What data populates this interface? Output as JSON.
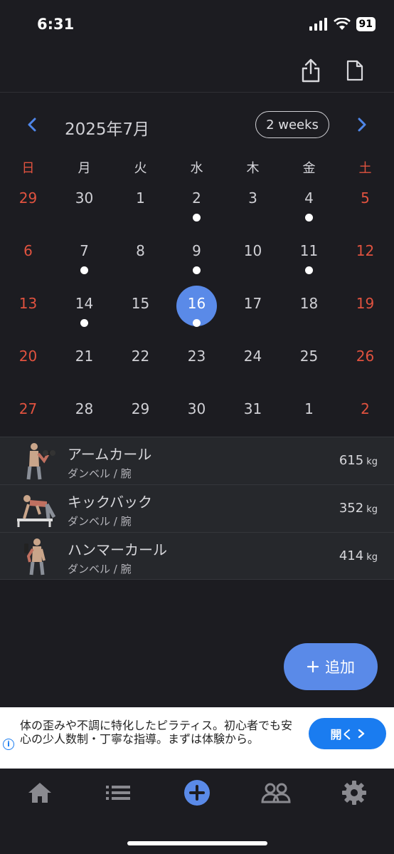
{
  "status": {
    "time": "6:31",
    "battery": "91"
  },
  "header": {
    "share_icon": "share-icon",
    "doc_icon": "document-icon"
  },
  "calendar": {
    "month_label": "2025年7月",
    "range_button": "2 weeks",
    "weekdays": [
      "日",
      "月",
      "火",
      "水",
      "木",
      "金",
      "土"
    ],
    "weeks": [
      [
        {
          "day": "29",
          "dot": false
        },
        {
          "day": "30",
          "dot": false
        },
        {
          "day": "1",
          "dot": false
        },
        {
          "day": "2",
          "dot": true
        },
        {
          "day": "3",
          "dot": false
        },
        {
          "day": "4",
          "dot": true
        },
        {
          "day": "5",
          "dot": false
        }
      ],
      [
        {
          "day": "6",
          "dot": false
        },
        {
          "day": "7",
          "dot": true
        },
        {
          "day": "8",
          "dot": false
        },
        {
          "day": "9",
          "dot": true
        },
        {
          "day": "10",
          "dot": false
        },
        {
          "day": "11",
          "dot": true
        },
        {
          "day": "12",
          "dot": false
        }
      ],
      [
        {
          "day": "13",
          "dot": false
        },
        {
          "day": "14",
          "dot": true
        },
        {
          "day": "15",
          "dot": false
        },
        {
          "day": "16",
          "dot": true,
          "selected": true
        },
        {
          "day": "17",
          "dot": false
        },
        {
          "day": "18",
          "dot": false
        },
        {
          "day": "19",
          "dot": false
        }
      ],
      [
        {
          "day": "20",
          "dot": false
        },
        {
          "day": "21",
          "dot": false
        },
        {
          "day": "22",
          "dot": false
        },
        {
          "day": "23",
          "dot": false
        },
        {
          "day": "24",
          "dot": false
        },
        {
          "day": "25",
          "dot": false
        },
        {
          "day": "26",
          "dot": false
        }
      ],
      [
        {
          "day": "27",
          "dot": false
        },
        {
          "day": "28",
          "dot": false
        },
        {
          "day": "29",
          "dot": false
        },
        {
          "day": "30",
          "dot": false
        },
        {
          "day": "31",
          "dot": false
        },
        {
          "day": "1",
          "dot": false
        },
        {
          "day": "2",
          "dot": false
        }
      ]
    ]
  },
  "exercises": [
    {
      "name": "アームカール",
      "sub": "ダンベル / 腕",
      "weight": "615",
      "unit": "kg",
      "icon": "arm-curl-icon"
    },
    {
      "name": "キックバック",
      "sub": "ダンベル / 腕",
      "weight": "352",
      "unit": "kg",
      "icon": "kickback-icon"
    },
    {
      "name": "ハンマーカール",
      "sub": "ダンベル / 腕",
      "weight": "414",
      "unit": "kg",
      "icon": "hammer-curl-icon"
    }
  ],
  "fab": {
    "label": "追加"
  },
  "ad": {
    "text": "体の歪みや不調に特化したピラティス。初心者でも安心の少人数制・丁寧な指導。まずは体験から。",
    "button": "開く"
  },
  "tabs": [
    "home-icon",
    "list-icon",
    "add-icon",
    "community-icon",
    "settings-icon"
  ],
  "colors": {
    "accent": "#5a8ae8",
    "weekend": "#e0523f",
    "background": "#1c1c21"
  }
}
